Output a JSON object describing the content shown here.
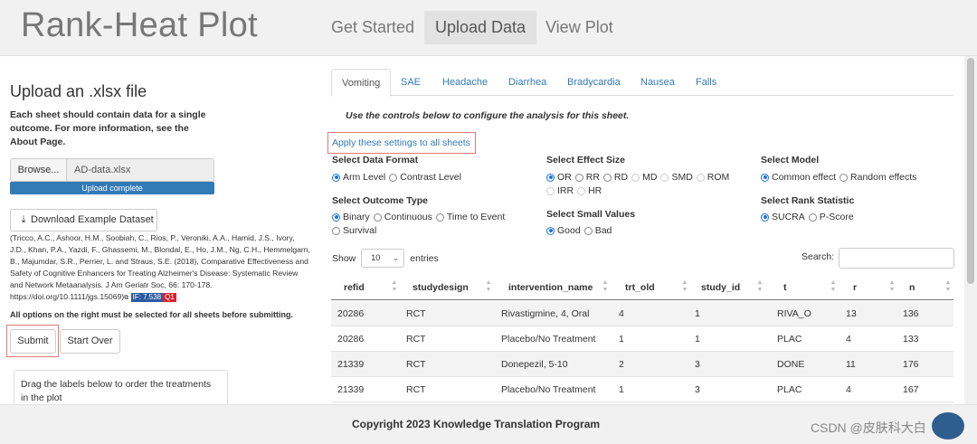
{
  "app": {
    "title": "Rank-Heat Plot"
  },
  "nav": [
    {
      "label": "Get Started"
    },
    {
      "label": "Upload Data"
    },
    {
      "label": "View Plot"
    }
  ],
  "sidebar": {
    "upload_title": "Upload an .xlsx file",
    "help_text": "Each sheet should contain data for a single outcome. For more information, see the About Page.",
    "browse_label": "Browse...",
    "file_name": "AD-data.xlsx",
    "progress_label": "Upload complete",
    "progress_percent": 100,
    "download_label": "Download Example Dataset",
    "citation": "(Tricco, A.C., Ashoor, H.M., Soobiah, C., Rios, P., Veroniki, A.A., Hamid, J.S., Ivory, J.D., Khan, P.A., Yazdi, F., Ghassemi, M., Blondal, E., Ho, J.M., Ng, C.H., Hemmelgarn, B., Majumdar, S.R., Perrier, L. and Straus, S.E. (2018), Comparative Effectiveness and Safety of Cognitive Enhancers for Treating Alzheimer's Disease: Systematic Review and Network Metaanalysis. J Am Geriatr Soc, 66: 170-178. https://doi.org/10.1111/jgs.15069)",
    "if_badge": "IF: 7.538",
    "q_badge": "Q1",
    "warning": "All options on the right must be selected for all sheets before submitting.",
    "submit_label": "Submit",
    "start_over_label": "Start Over",
    "drag_text": "Drag the labels below to order the treatments in the plot"
  },
  "sheets": [
    {
      "label": "Vomiting"
    },
    {
      "label": "SAE"
    },
    {
      "label": "Headache"
    },
    {
      "label": "Diarrhea"
    },
    {
      "label": "Bradycardia"
    },
    {
      "label": "Nausea"
    },
    {
      "label": "Falls"
    }
  ],
  "config": {
    "instructions": "Use the controls below to configure the analysis for this sheet.",
    "apply_all": "Apply these settings to all sheets",
    "data_format": {
      "label": "Select Data Format",
      "options": [
        "Arm Level",
        "Contrast Level"
      ],
      "selected": "Arm Level"
    },
    "outcome_type": {
      "label": "Select Outcome Type",
      "options": [
        "Binary",
        "Continuous",
        "Time to Event",
        "Survival"
      ],
      "selected": "Binary"
    },
    "effect_size": {
      "label": "Select Effect Size",
      "options": [
        "OR",
        "RR",
        "RD",
        "MD",
        "SMD",
        "ROM",
        "IRR",
        "HR"
      ],
      "selected": "OR"
    },
    "small_values": {
      "label": "Select Small Values",
      "options": [
        "Good",
        "Bad"
      ],
      "selected": "Good"
    },
    "model": {
      "label": "Select Model",
      "options": [
        "Common effect",
        "Random effects"
      ],
      "selected": "Common effect"
    },
    "rank_stat": {
      "label": "Select Rank Statistic",
      "options": [
        "SUCRA",
        "P-Score"
      ],
      "selected": "SUCRA"
    }
  },
  "table": {
    "show_label": "Show",
    "entries_value": "10",
    "entries_label": "entries",
    "search_label": "Search:",
    "search_value": "",
    "columns": [
      "refid",
      "studydesign",
      "intervention_name",
      "trt_old",
      "study_id",
      "t",
      "r",
      "n"
    ],
    "rows": [
      [
        "20286",
        "RCT",
        "Rivastigmine, 4, Oral",
        "4",
        "1",
        "RIVA_O",
        "13",
        "136"
      ],
      [
        "20286",
        "RCT",
        "Placebo/No Treatment",
        "1",
        "1",
        "PLAC",
        "4",
        "133"
      ],
      [
        "21339",
        "RCT",
        "Donepezil, 5-10",
        "2",
        "3",
        "DONE",
        "11",
        "176"
      ],
      [
        "21339",
        "RCT",
        "Placebo/No Treatment",
        "1",
        "3",
        "PLAC",
        "4",
        "167"
      ]
    ]
  },
  "footer": {
    "copyright": "Copyright 2023 Knowledge Translation Program",
    "watermark": "CSDN @皮肤科大白"
  },
  "colors": {
    "accent": "#337ab7",
    "highlight": "#e07a7a",
    "progress": "#337ab7"
  }
}
